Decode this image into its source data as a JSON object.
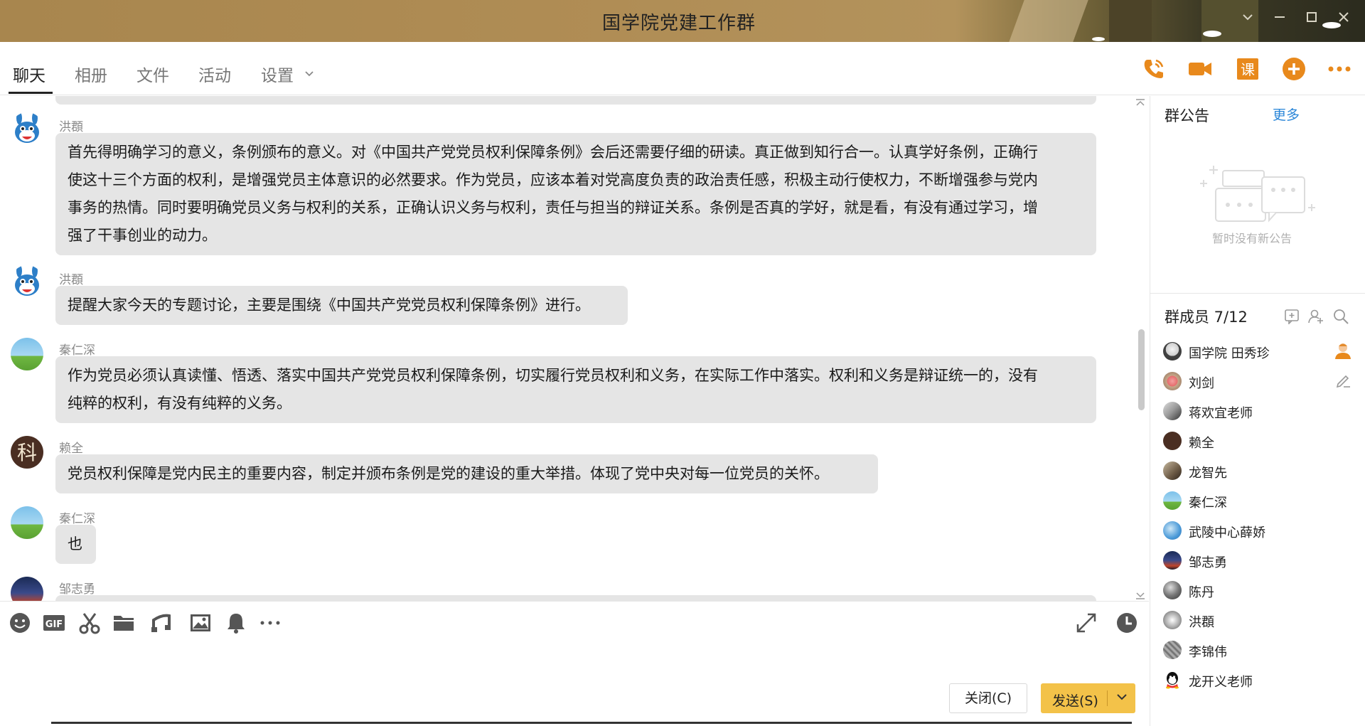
{
  "window": {
    "title": "国学院党建工作群"
  },
  "tabs": [
    {
      "label": "聊天"
    },
    {
      "label": "相册"
    },
    {
      "label": "文件"
    },
    {
      "label": "活动"
    },
    {
      "label": "设置"
    }
  ],
  "messages": [
    {
      "sender": "洪頵",
      "lines": [
        "首先得明确学习的意义，条例颁布的意义。对《中国共产党党员权利保障条例》会后还需要仔细的研读。真正做到知行合一。认真学好条例，正确行",
        "使这十三个方面的权利，是增强党员主体意识的必然要求。作为党员，应该本着对党高度负责的政治责任感，积极主动行使权力，不断增强参与党内",
        "事务的热情。同时要明确党员义务与权利的关系，正确认识义务与权利，责任与担当的辩证关系。条例是否真的学好，就是看，有没有通过学习，增",
        "强了干事创业的动力。"
      ]
    },
    {
      "sender": "洪頵",
      "lines": [
        "提醒大家今天的专题讨论，主要是围绕《中国共产党党员权利保障条例》进行。"
      ]
    },
    {
      "sender": "秦仁深",
      "lines": [
        "作为党员必须认真读懂、悟透、落实中国共产党党员权利保障条例，切实履行党员权利和义务，在实际工作中落实。权利和义务是辩证统一的，没有",
        "纯粹的权利，有没有纯粹的义务。"
      ]
    },
    {
      "sender": "赖全",
      "lines": [
        "党员权利保障是党内民主的重要内容，制定并颁布条例是党的建设的重大举措。体现了党中央对每一位党员的关怀。"
      ]
    },
    {
      "sender": "秦仁深",
      "lines": [
        "也"
      ]
    },
    {
      "sender": "邹志勇",
      "lines": []
    }
  ],
  "avatar_glyph_lai": "科",
  "toolbar": {
    "gif_label": "GIF"
  },
  "buttons": {
    "close_label": "关闭(C)",
    "send_label": "发送(S)"
  },
  "announcement": {
    "title": "群公告",
    "more_label": "更多",
    "empty_text": "暂时没有新公告"
  },
  "members": {
    "title": "群成员 7/12",
    "list": [
      {
        "name": "国学院 田秀珍"
      },
      {
        "name": "刘剑"
      },
      {
        "name": "蒋欢宜老师"
      },
      {
        "name": "赖全"
      },
      {
        "name": "龙智先"
      },
      {
        "name": "秦仁深"
      },
      {
        "name": "武陵中心薛娇"
      },
      {
        "name": "邹志勇"
      },
      {
        "name": "陈丹"
      },
      {
        "name": "洪頵"
      },
      {
        "name": "李锦伟"
      },
      {
        "name": "龙开义老师"
      }
    ]
  },
  "colors": {
    "accent": "#e8891c",
    "send": "#f3c249",
    "link": "#2a86d8",
    "bubble": "#e5e5e5"
  }
}
